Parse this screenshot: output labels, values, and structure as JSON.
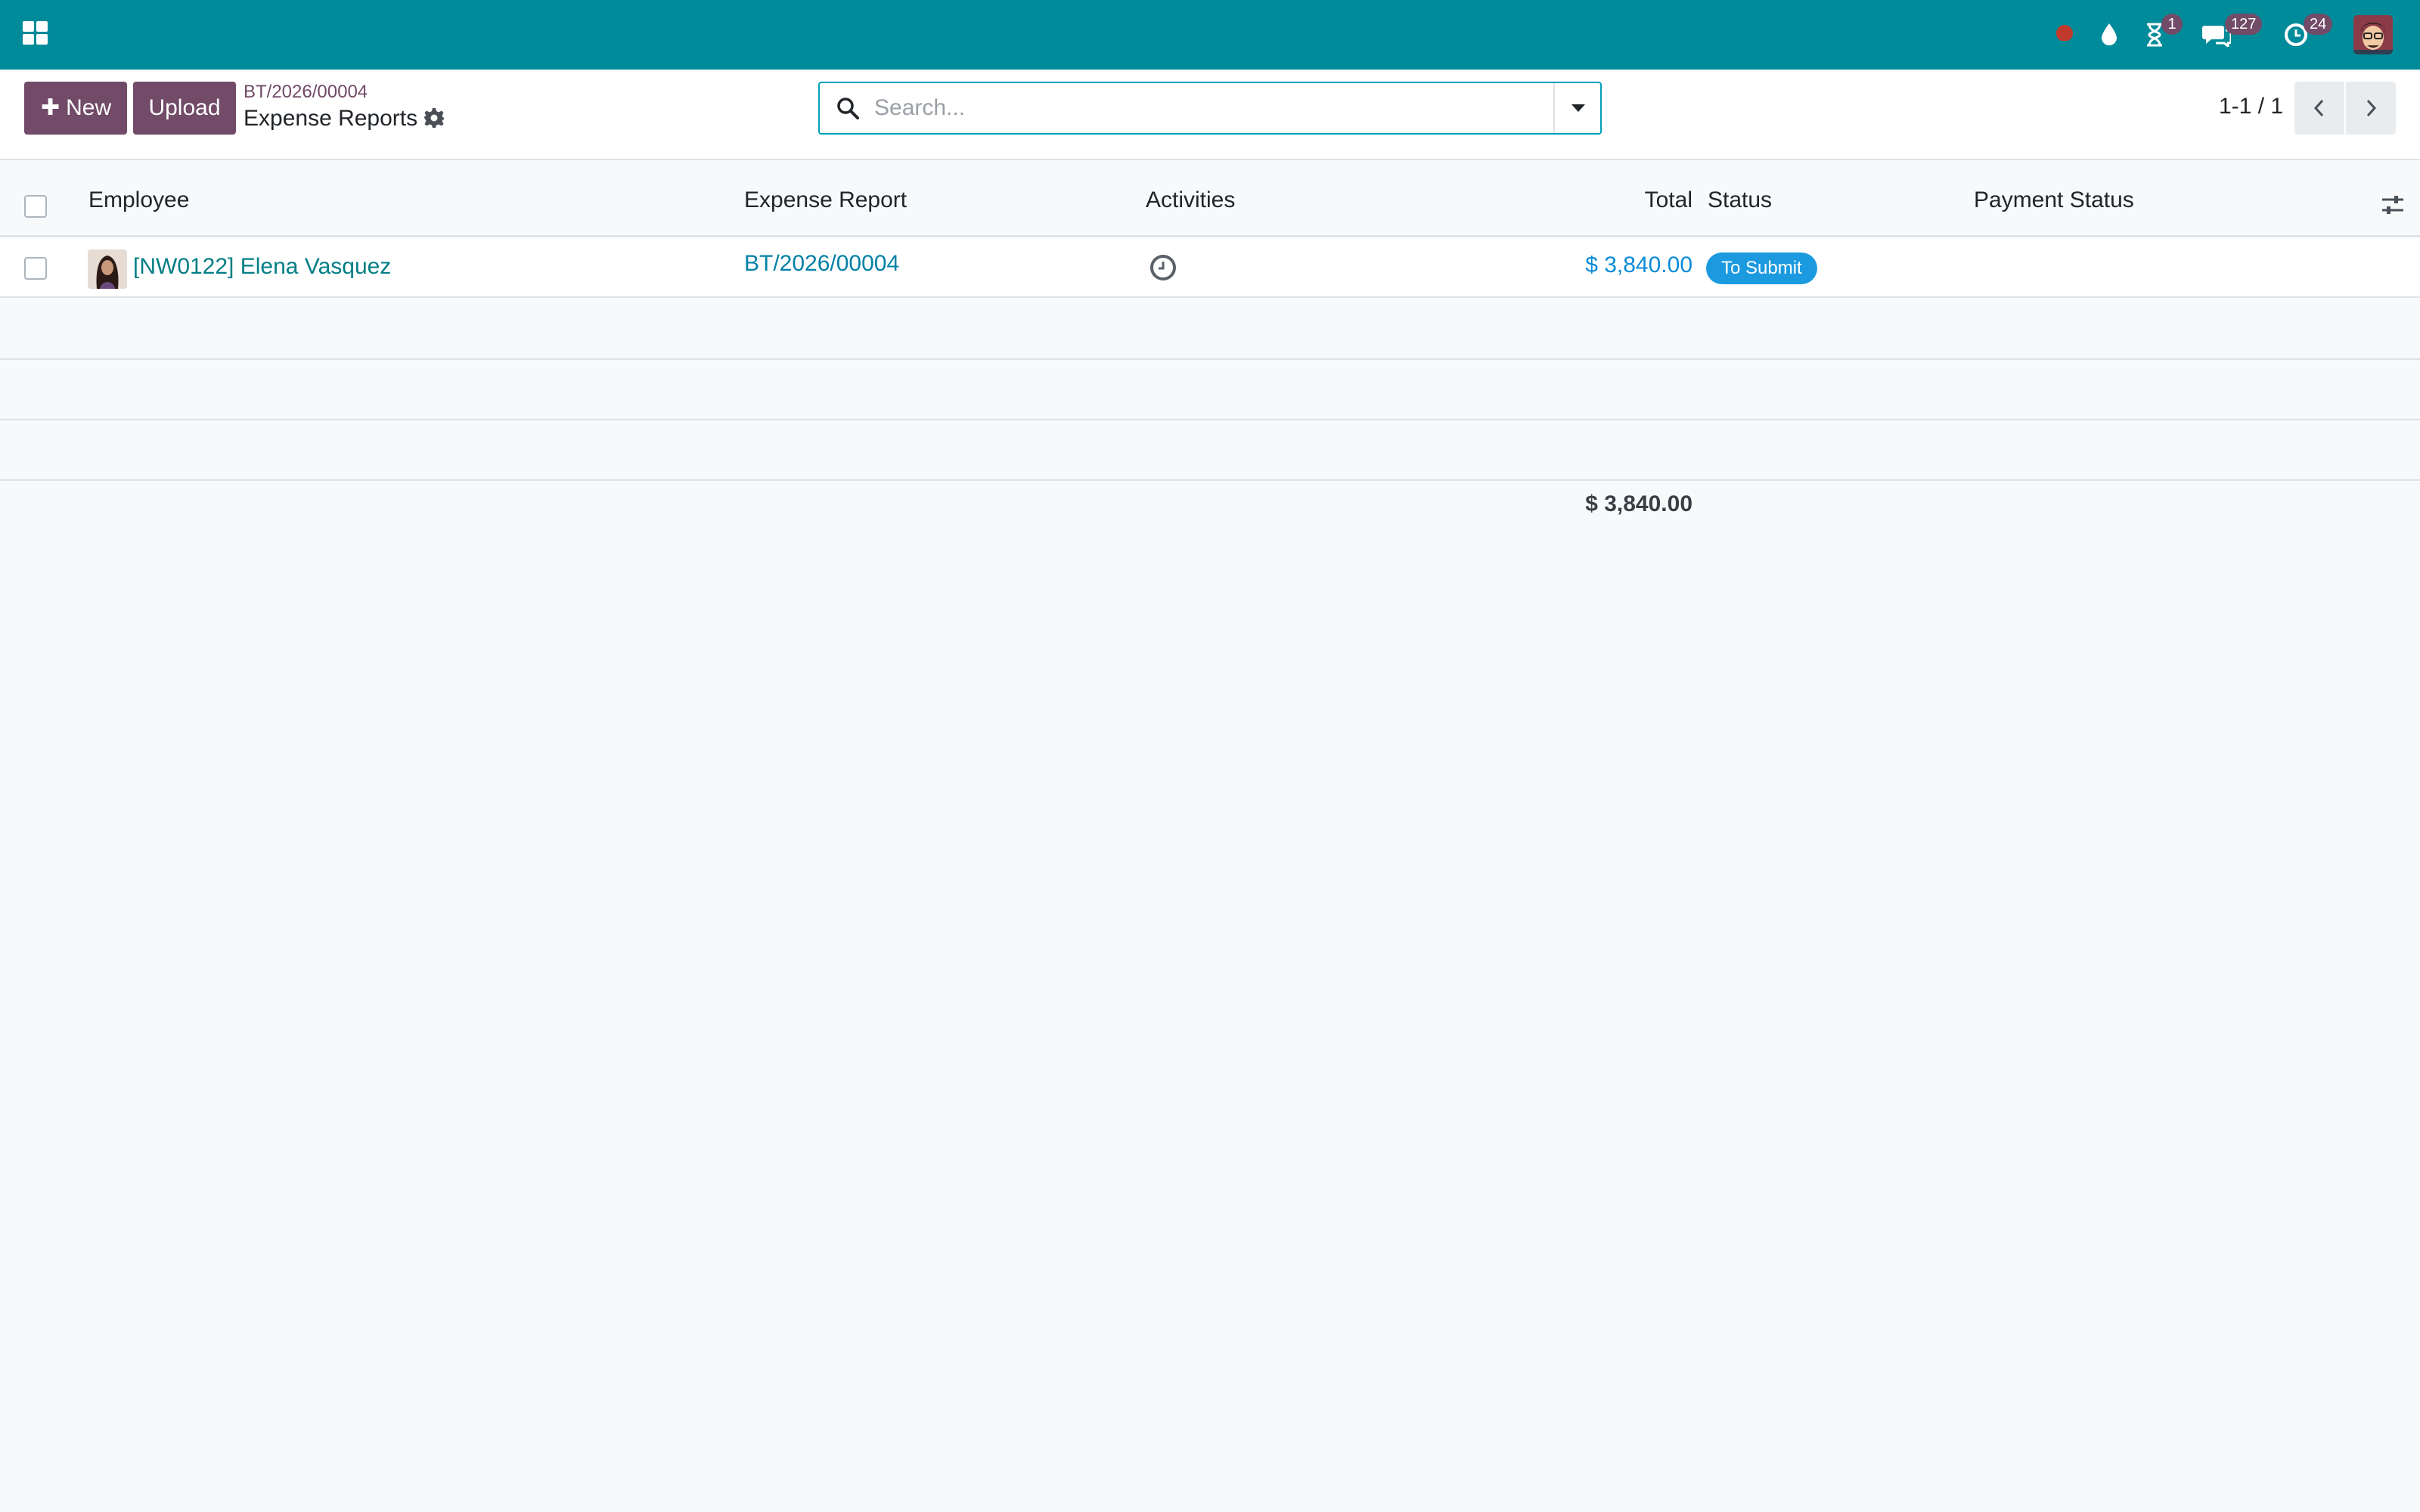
{
  "topbar": {
    "apps_icon": "grid-icon",
    "systray": {
      "recording_icon": "record-dot-icon",
      "drop_icon": "water-drop-icon",
      "activities_badge": "1",
      "messages_badge": "127",
      "clock_badge": "24"
    },
    "colors": {
      "topbar": "#008b9a",
      "brand": "#714b67"
    }
  },
  "control_panel": {
    "new_label": "New",
    "upload_label": "Upload",
    "breadcrumb": "BT/2026/00004",
    "title": "Expense Reports",
    "search": {
      "placeholder": "Search...",
      "value": ""
    },
    "pager": "1-1 / 1"
  },
  "list": {
    "columns": {
      "employee": "Employee",
      "expense_report": "Expense Report",
      "activities": "Activities",
      "total": "Total",
      "status": "Status",
      "payment_status": "Payment Status"
    },
    "rows": [
      {
        "employee": "[NW0122] Elena Vasquez",
        "expense_report": "BT/2026/00004",
        "activity_icon": "clock-icon",
        "total": "$ 3,840.00",
        "status": "To Submit",
        "payment_status": ""
      }
    ],
    "grand_total": "$ 3,840.00"
  }
}
